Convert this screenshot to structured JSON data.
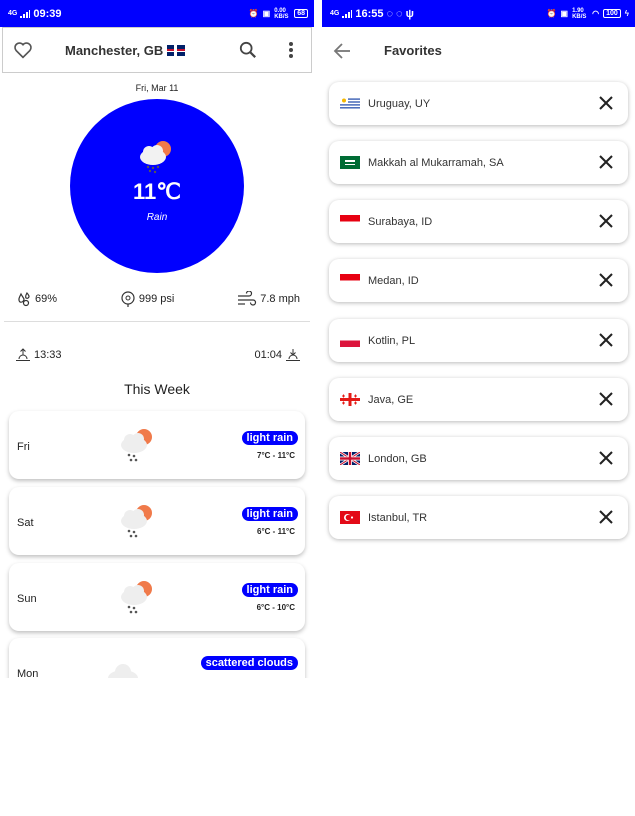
{
  "left_screen": {
    "status": {
      "time": "09:39",
      "network": "4G",
      "data_rate": "0.00 KB/S",
      "battery": "68"
    },
    "appbar": {
      "title": "Manchester, GB"
    },
    "current": {
      "date": "Fri, Mar 11",
      "temp": "11℃",
      "condition": "Rain",
      "humidity": "69%",
      "pressure": "999 psi",
      "wind": "7.8 mph",
      "sunrise": "13:33",
      "sunset": "01:04"
    },
    "week_title": "This Week",
    "days": [
      {
        "name": "Fri",
        "badge": "light rain",
        "range": "7°C - 11°C"
      },
      {
        "name": "Sat",
        "badge": "light rain",
        "range": "6°C - 11°C"
      },
      {
        "name": "Sun",
        "badge": "light rain",
        "range": "6°C - 10°C"
      },
      {
        "name": "Mon",
        "badge": "scattered clouds",
        "range": ""
      }
    ]
  },
  "right_screen": {
    "status": {
      "time": "16:55",
      "network": "4G",
      "data_rate": "1.90 KB/S",
      "battery": "100"
    },
    "title": "Favorites",
    "favorites": [
      {
        "name": "Uruguay, UY",
        "flag": "uy"
      },
      {
        "name": "Makkah al Mukarramah, SA",
        "flag": "sa"
      },
      {
        "name": "Surabaya, ID",
        "flag": "id"
      },
      {
        "name": "Medan, ID",
        "flag": "id"
      },
      {
        "name": "Kotlin, PL",
        "flag": "pl"
      },
      {
        "name": "Java, GE",
        "flag": "ge"
      },
      {
        "name": "London, GB",
        "flag": "gb"
      },
      {
        "name": "Istanbul, TR",
        "flag": "tr"
      }
    ]
  },
  "colors": {
    "accent": "#0000ff",
    "sun": "#f07a4a"
  },
  "icons": {
    "favorite": "heart-outline-icon",
    "search": "search-icon",
    "more": "more-vert-icon",
    "back": "arrow-back-icon",
    "remove": "close-icon"
  }
}
